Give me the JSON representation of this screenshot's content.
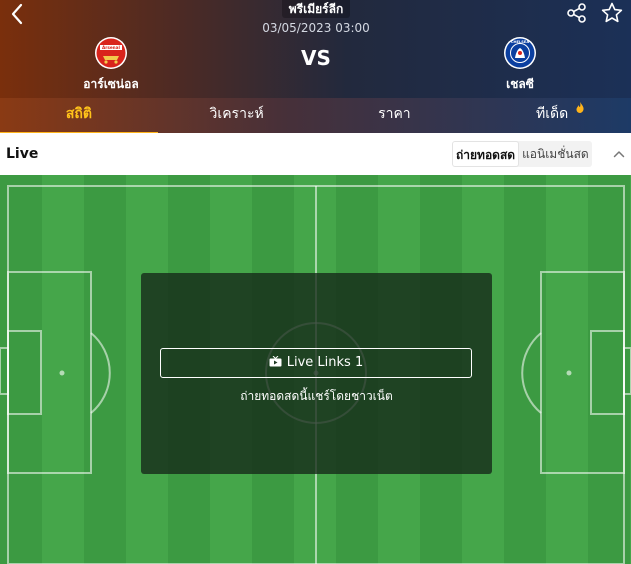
{
  "header": {
    "league": "พรีเมียร์ลีก",
    "datetime": "03/05/2023 03:00",
    "vs": "VS",
    "home_team": "อาร์เซน่อล",
    "away_team": "เชลซี",
    "home_crest_text": "Arsenal",
    "away_crest_text": "CHELSEA"
  },
  "tabs": [
    {
      "label": "สถิติ",
      "active": true
    },
    {
      "label": "วิเคราะห์"
    },
    {
      "label": "ราคา"
    },
    {
      "label": "ทีเด็ด",
      "icon": "fire-icon"
    }
  ],
  "live": {
    "title": "Live",
    "segment_live": "ถ่ายทอดสด",
    "segment_animation": "แอนิเมชั่นสด"
  },
  "overlay": {
    "button_label": "Live Links 1",
    "caption": "ถ่ายทอดสดนี้แชร์โดยชาวเน็ต"
  },
  "colors": {
    "accent": "#ffb41a",
    "arsenal_red": "#d9241c",
    "chelsea_blue": "#0b3fa0",
    "pitch_light": "#45a64a",
    "pitch_dark": "#3c9a42"
  }
}
